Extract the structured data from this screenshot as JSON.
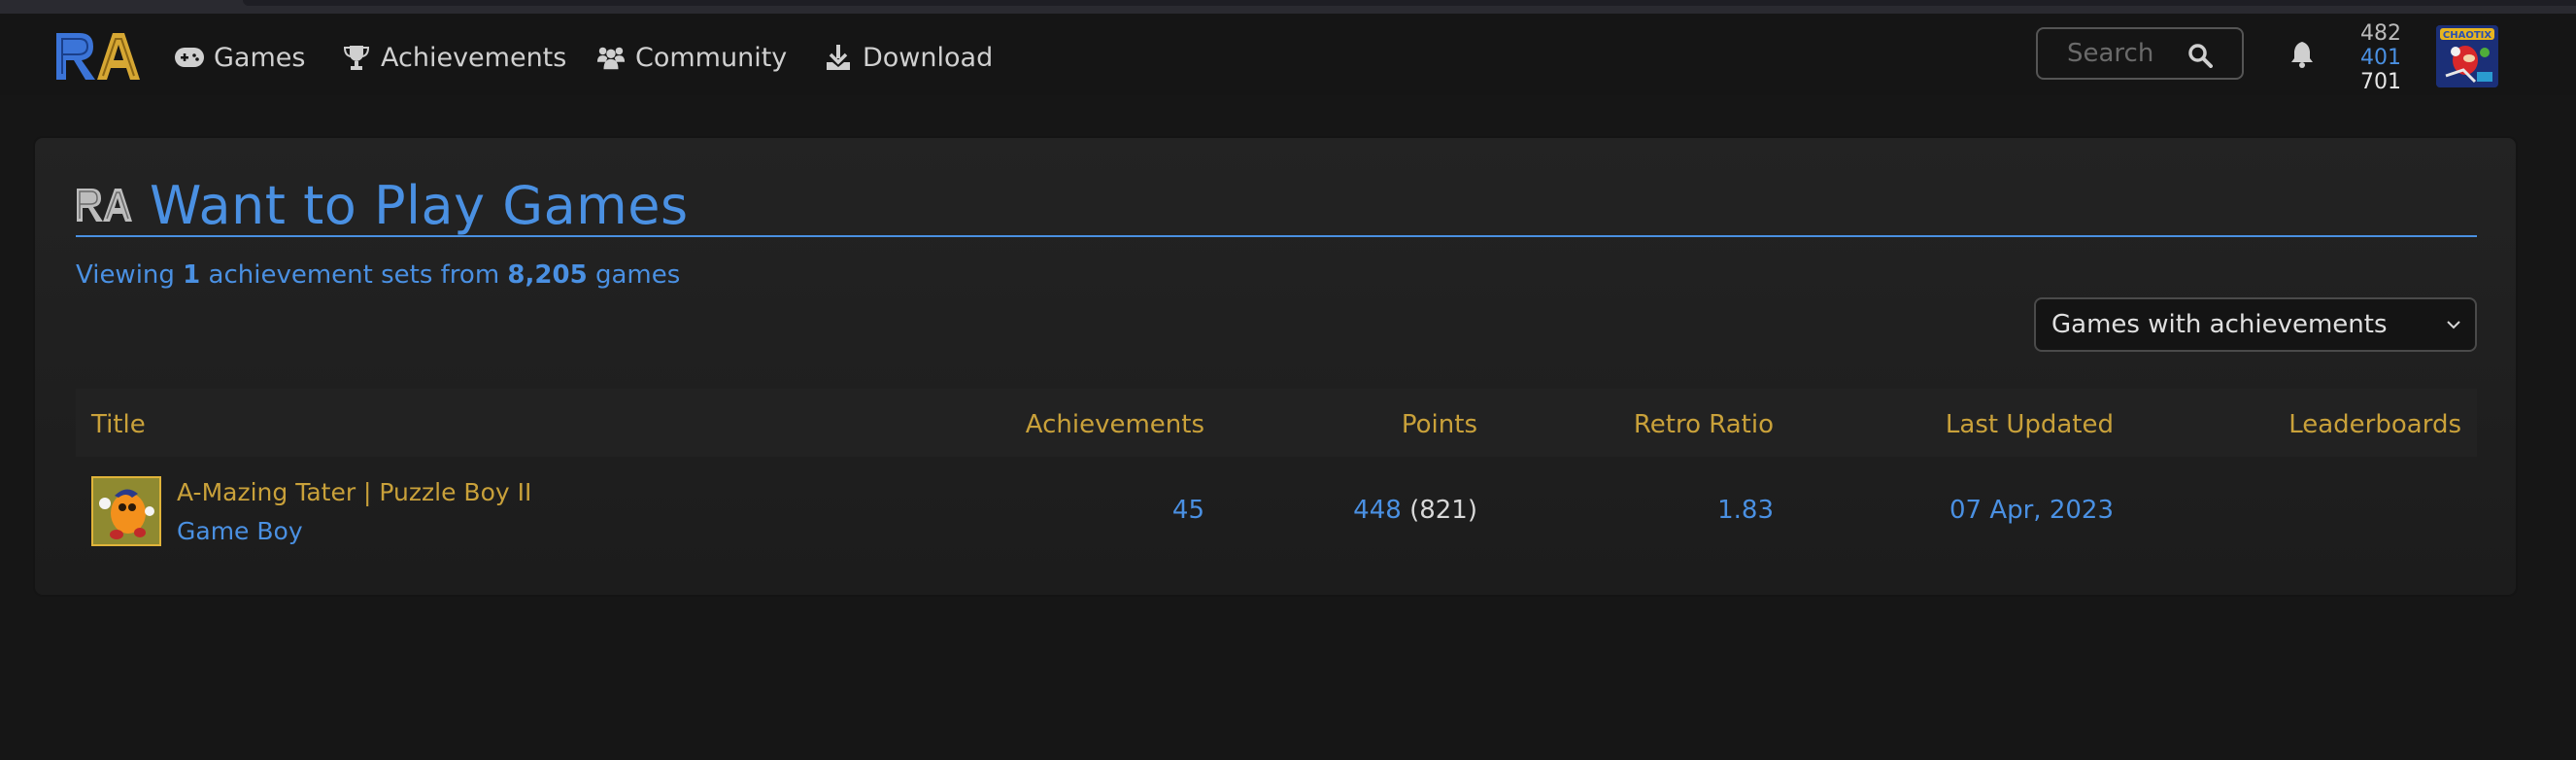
{
  "nav": {
    "logo": "RetroAchievements",
    "items": [
      {
        "label": "Games",
        "icon": "gamepad-icon"
      },
      {
        "label": "Achievements",
        "icon": "trophy-icon"
      },
      {
        "label": "Community",
        "icon": "users-icon"
      },
      {
        "label": "Download",
        "icon": "download-icon"
      }
    ],
    "search_placeholder": "Search",
    "user_stats": {
      "hardcore_points": "482",
      "retro_points": "401",
      "softcore_points": "701"
    },
    "avatar_label": "Chaotix"
  },
  "page": {
    "title": "Want to Play Games",
    "viewing": {
      "prefix": "Viewing",
      "count": "1",
      "middle": "achievement sets from",
      "total": "8,205",
      "suffix": "games"
    },
    "filter": {
      "selected": "Games with achievements"
    }
  },
  "table": {
    "headers": [
      "Title",
      "Achievements",
      "Points",
      "Retro Ratio",
      "Last Updated",
      "Leaderboards"
    ],
    "rows": [
      {
        "title": "A-Mazing Tater | Puzzle Boy II",
        "console": "Game Boy",
        "achievements": "45",
        "points": "448",
        "retro_points": "(821)",
        "retro_ratio": "1.83",
        "last_updated": "07 Apr, 2023",
        "leaderboards": ""
      }
    ]
  },
  "colors": {
    "accent_blue": "#4a90e2",
    "accent_gold": "#c9a13a",
    "background": "#161616",
    "panel": "#222222"
  }
}
